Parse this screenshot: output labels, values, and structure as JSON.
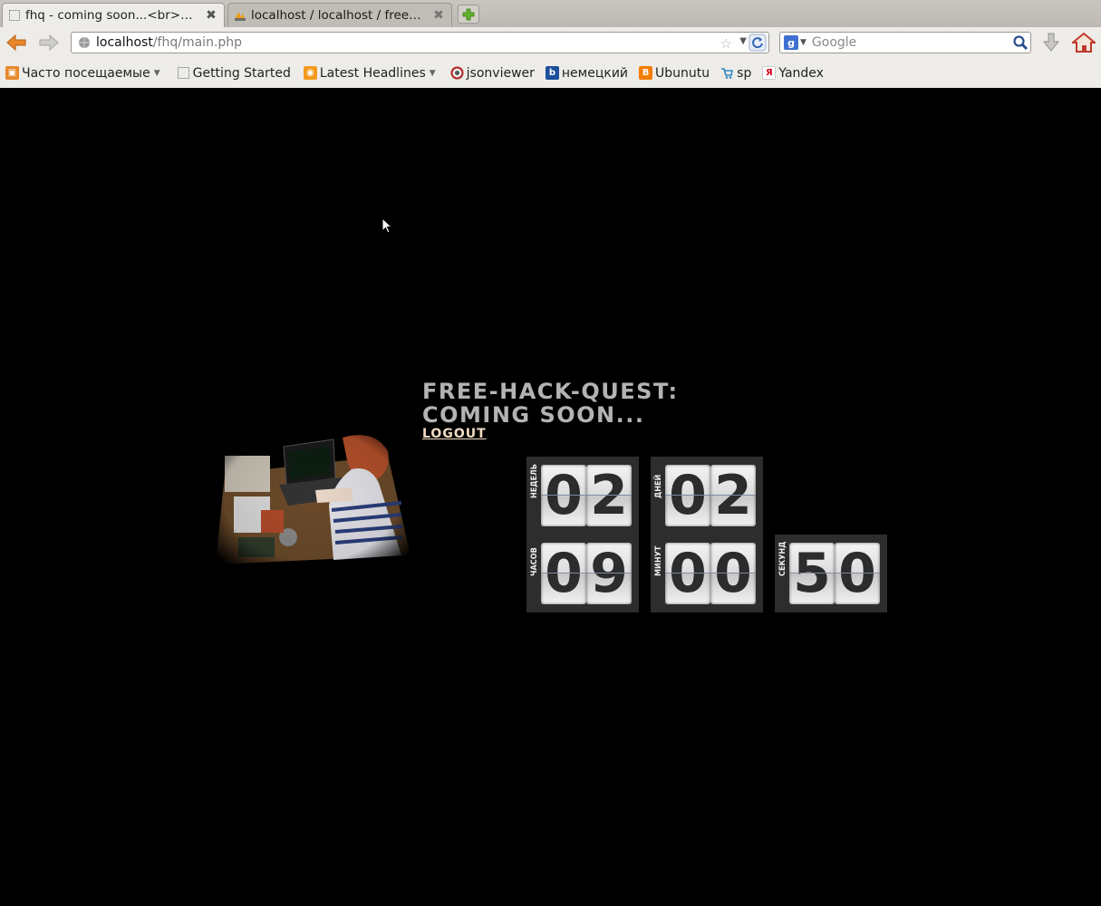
{
  "browser": {
    "tabs": [
      {
        "title": "fhq - coming soon...<br><fo...",
        "active": true
      },
      {
        "title": "localhost / localhost / freeh...",
        "active": false
      }
    ],
    "url": {
      "host": "localhost",
      "path": "/fhq/main.php"
    },
    "search": {
      "placeholder": "Google"
    },
    "bookmarks": [
      {
        "label": "Часто посещаемые",
        "icon": "most-visited-icon",
        "dropdown": true
      },
      {
        "label": "Getting Started",
        "icon": "page-icon",
        "dropdown": false
      },
      {
        "label": "Latest Headlines",
        "icon": "rss-icon",
        "dropdown": true
      },
      {
        "label": "jsonviewer",
        "icon": "jsonviewer-icon",
        "dropdown": false
      },
      {
        "label": "немецкий",
        "icon": "b-icon",
        "dropdown": false
      },
      {
        "label": "Ubunutu",
        "icon": "blogger-icon",
        "dropdown": false
      },
      {
        "label": "sp",
        "icon": "cart-icon",
        "dropdown": false
      },
      {
        "label": "Yandex",
        "icon": "yandex-icon",
        "dropdown": false
      }
    ]
  },
  "page": {
    "headline": [
      "Free-Hack-Quest:",
      "Coming soon..."
    ],
    "logout_label": "Logout",
    "countdown": {
      "weeks": {
        "label": "НЕДЕЛЬ",
        "value": "02"
      },
      "days": {
        "label": "ДНЕЙ",
        "value": "02"
      },
      "hours": {
        "label": "ЧАСОВ",
        "value": "09"
      },
      "minutes": {
        "label": "МИНУТ",
        "value": "00"
      },
      "seconds": {
        "label": "СЕКУНД",
        "value": "50"
      }
    }
  }
}
